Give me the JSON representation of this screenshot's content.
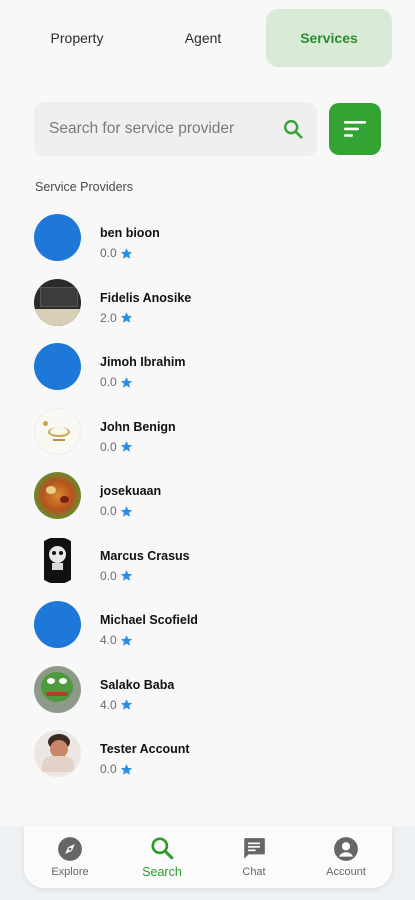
{
  "tabs": [
    {
      "label": "Property",
      "active": false
    },
    {
      "label": "Agent",
      "active": false
    },
    {
      "label": "Services",
      "active": true
    }
  ],
  "search": {
    "placeholder": "Search for service provider",
    "value": ""
  },
  "section_title": "Service Providers",
  "providers": [
    {
      "name": "ben bioon",
      "rating": "0.0",
      "avatar": "blue-circle"
    },
    {
      "name": "Fidelis Anosike",
      "rating": "2.0",
      "avatar": "chalkboard-photo"
    },
    {
      "name": "Jimoh Ibrahim",
      "rating": "0.0",
      "avatar": "blue-circle"
    },
    {
      "name": "John Benign",
      "rating": "0.0",
      "avatar": "eid-card-photo"
    },
    {
      "name": "josekuaan",
      "rating": "0.0",
      "avatar": "food-photo"
    },
    {
      "name": "Marcus Crasus",
      "rating": "0.0",
      "avatar": "skull-photo"
    },
    {
      "name": "Michael Scofield",
      "rating": "4.0",
      "avatar": "blue-circle"
    },
    {
      "name": "Salako Baba",
      "rating": "4.0",
      "avatar": "green-frog-photo"
    },
    {
      "name": "Tester Account",
      "rating": "0.0",
      "avatar": "person-photo"
    }
  ],
  "nav": [
    {
      "label": "Explore",
      "icon": "compass-icon",
      "active": false
    },
    {
      "label": "Search",
      "icon": "search-icon",
      "active": true
    },
    {
      "label": "Chat",
      "icon": "chat-icon",
      "active": false
    },
    {
      "label": "Account",
      "icon": "account-icon",
      "active": false
    }
  ],
  "colors": {
    "accent": "#33a333",
    "star": "#2a8ee6",
    "avatar_blue": "#1d78d8"
  }
}
